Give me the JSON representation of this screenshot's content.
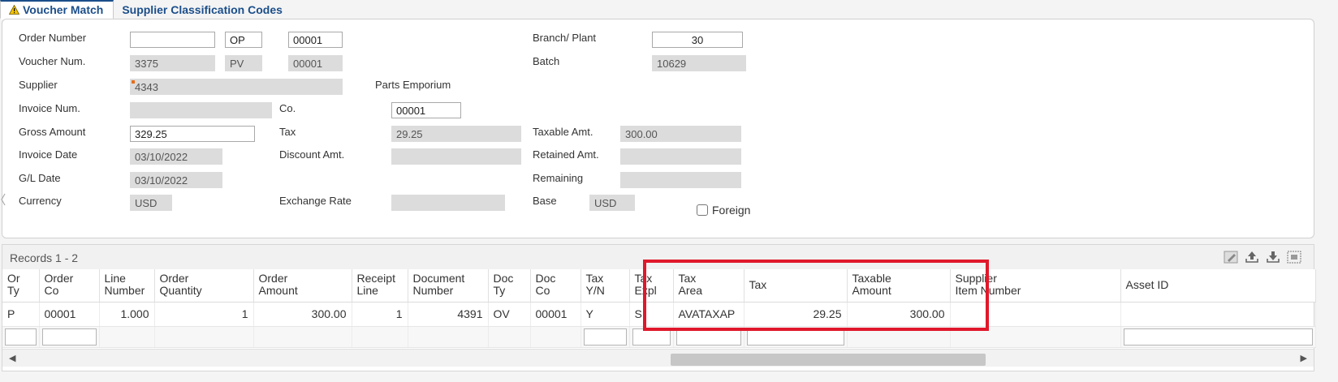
{
  "tabs": [
    {
      "label": "Voucher Match",
      "active": true
    },
    {
      "label": "Supplier Classification Codes",
      "active": false
    }
  ],
  "form": {
    "order_number": {
      "label": "Order Number",
      "value": "",
      "type": "OP",
      "company": "00001"
    },
    "voucher_num": {
      "label": "Voucher Num.",
      "value": "3375",
      "type": "PV",
      "company": "00001"
    },
    "supplier": {
      "label": "Supplier",
      "value": "4343",
      "name": "Parts Emporium"
    },
    "invoice_num": {
      "label": "Invoice Num.",
      "value": ""
    },
    "co": {
      "label": "Co.",
      "value": "00001"
    },
    "gross_amount": {
      "label": "Gross Amount",
      "value": "329.25"
    },
    "tax": {
      "label": "Tax",
      "value": "29.25"
    },
    "taxable_amt": {
      "label": "Taxable Amt.",
      "value": "300.00"
    },
    "invoice_date": {
      "label": "Invoice Date",
      "value": "03/10/2022"
    },
    "discount_amt": {
      "label": "Discount Amt.",
      "value": ""
    },
    "retained_amt": {
      "label": "Retained Amt.",
      "value": ""
    },
    "gl_date": {
      "label": "G/L Date",
      "value": "03/10/2022"
    },
    "remaining": {
      "label": "Remaining",
      "value": ""
    },
    "currency": {
      "label": "Currency",
      "value": "USD"
    },
    "exchange_rate": {
      "label": "Exchange Rate",
      "value": ""
    },
    "base": {
      "label": "Base",
      "value": "USD"
    },
    "foreign": {
      "label": "Foreign",
      "checked": false
    },
    "branch_plant": {
      "label": "Branch/ Plant",
      "value": "30"
    },
    "batch": {
      "label": "Batch",
      "value": "10629"
    }
  },
  "grid": {
    "records_label": "Records 1 - 2",
    "columns": [
      {
        "l1": "Or",
        "l2": "Ty"
      },
      {
        "l1": "Order",
        "l2": "Co"
      },
      {
        "l1": "Line",
        "l2": "Number"
      },
      {
        "l1": "Order",
        "l2": "Quantity"
      },
      {
        "l1": "Order",
        "l2": "Amount"
      },
      {
        "l1": "Receipt",
        "l2": "Line"
      },
      {
        "l1": "Document",
        "l2": "Number"
      },
      {
        "l1": "Doc",
        "l2": "Ty"
      },
      {
        "l1": "Doc",
        "l2": "Co"
      },
      {
        "l1": "Tax",
        "l2": "Y/N"
      },
      {
        "l1": "Tax",
        "l2": "Expl"
      },
      {
        "l1": "Tax",
        "l2": "Area"
      },
      {
        "l1": "Tax",
        "l2": ""
      },
      {
        "l1": "Taxable",
        "l2": "Amount"
      },
      {
        "l1": "Supplier",
        "l2": "Item Number"
      },
      {
        "l1": "Asset ID",
        "l2": ""
      }
    ],
    "rows": [
      [
        "P",
        "00001",
        "1.000",
        "1",
        "300.00",
        "1",
        "4391",
        "OV",
        "00001",
        "Y",
        "S",
        "AVATAXAP",
        "29.25",
        "300.00",
        "",
        ""
      ]
    ]
  },
  "icons": {
    "warning": "warning-triangle-icon",
    "edit": "edit-grid-icon",
    "upload": "upload-icon",
    "download": "download-icon",
    "fit": "fit-to-screen-icon"
  },
  "colors": {
    "tab_text": "#1b4e8a",
    "highlight": "#e0182b"
  }
}
